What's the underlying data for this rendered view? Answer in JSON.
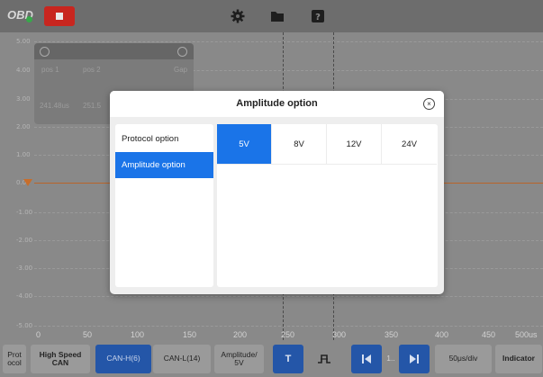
{
  "topbar": {
    "logo": "OBD",
    "icons": [
      "settings-gear-icon",
      "folder-icon",
      "help-icon"
    ]
  },
  "measurement_panel": {
    "col1_header": "pos 1",
    "col2_header": "pos 2",
    "col3_header": "Gap",
    "col1_value": "241.48us",
    "col2_value": "251.5"
  },
  "y_axis": {
    "labels": [
      "5.00",
      "4.00",
      "3.00",
      "2.00",
      "1.00",
      "0.00",
      "-1.00",
      "-2.00",
      "-3.00",
      "-4.00",
      "-5.00"
    ]
  },
  "x_axis": {
    "labels": [
      "0",
      "50",
      "100",
      "150",
      "200",
      "250",
      "300",
      "350",
      "400",
      "450",
      "500us"
    ]
  },
  "dialog": {
    "title": "Amplitude option",
    "menu": [
      "Protocol option",
      "Amplitude option"
    ],
    "options": [
      "5V",
      "8V",
      "12V",
      "24V"
    ],
    "selected_option": "5V"
  },
  "bottom_toolbar": {
    "protocol_label": "Prot\nocol",
    "speed_label": "High Speed\nCAN",
    "can_h": "CAN-H(6)",
    "can_l": "CAN-L(14)",
    "amplitude": "Amplitude/\n5V",
    "trigger": "T",
    "page_value": "1..",
    "timebase": "50μs/div",
    "indicator": "Indicator"
  },
  "colors": {
    "accent": "#1a74e8",
    "stop": "#c8261f",
    "waveform": "#c76e2c"
  }
}
